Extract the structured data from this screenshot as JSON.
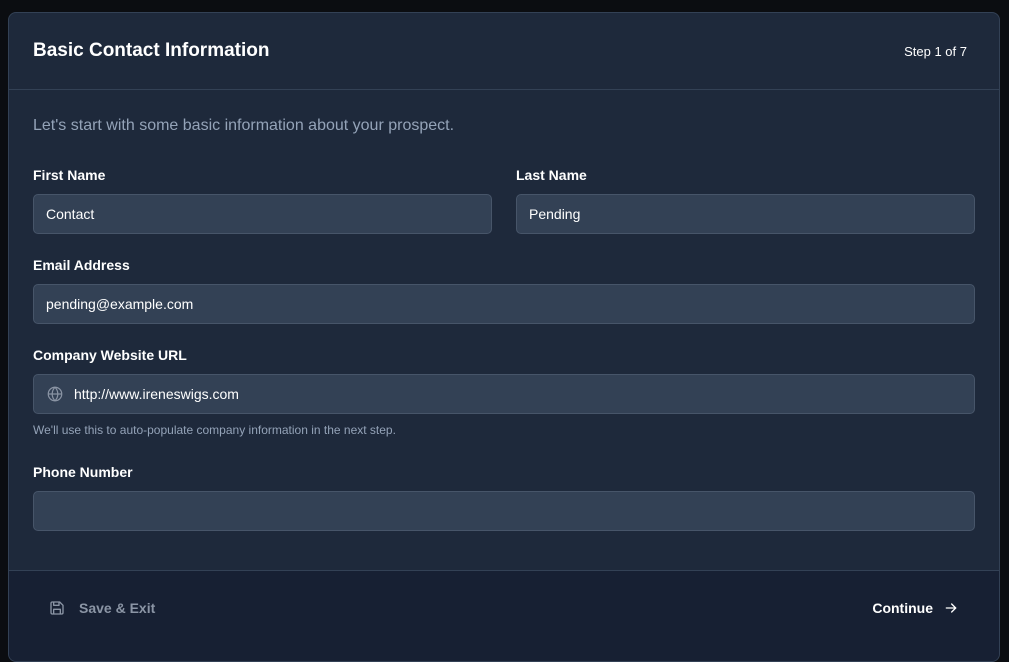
{
  "header": {
    "title": "Basic Contact Information",
    "step": "Step 1 of 7"
  },
  "intro": "Let's start with some basic information about your prospect.",
  "fields": {
    "first_name": {
      "label": "First Name",
      "value": "Contact"
    },
    "last_name": {
      "label": "Last Name",
      "value": "Pending"
    },
    "email": {
      "label": "Email Address",
      "value": "pending@example.com"
    },
    "website": {
      "label": "Company Website URL",
      "value": "http://www.ireneswigs.com",
      "hint": "We'll use this to auto-populate company information in the next step.",
      "icon": "globe-icon"
    },
    "phone": {
      "label": "Phone Number",
      "value": ""
    }
  },
  "footer": {
    "save_label": "Save & Exit",
    "save_icon": "save-icon",
    "continue_label": "Continue",
    "continue_icon": "arrow-right-icon"
  },
  "colors": {
    "card_bg": "#1e293b",
    "input_bg": "#334155",
    "border": "#475569",
    "muted_text": "#94a3b8"
  }
}
